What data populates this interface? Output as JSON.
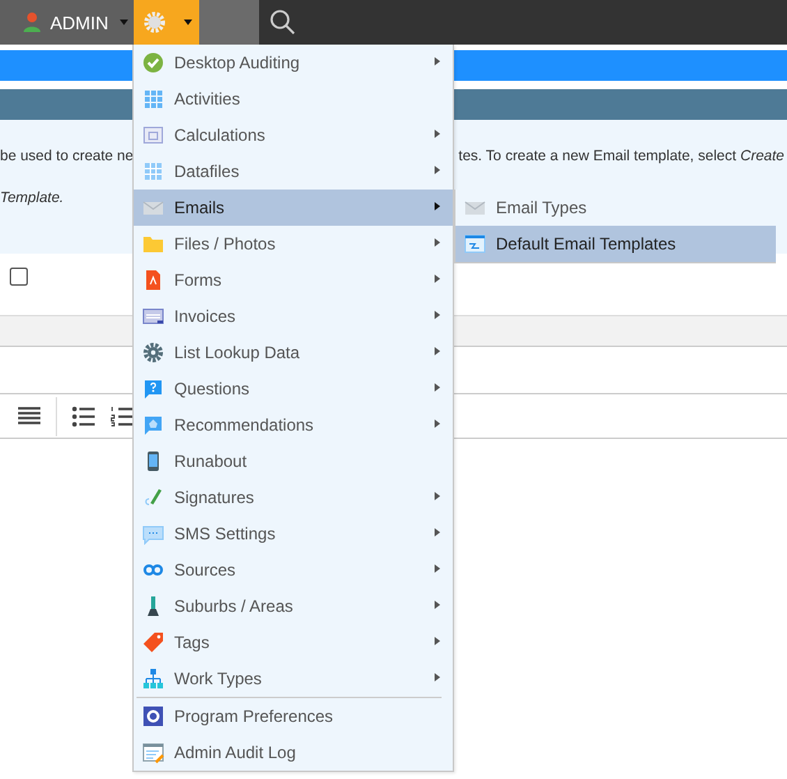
{
  "topbar": {
    "user": "ADMIN"
  },
  "intro": {
    "left": "be used to create ne",
    "right": "tes. To create a new Email template, select *Create*",
    "line2": "Template."
  },
  "checkbox": {
    "checked": false
  },
  "admin_menu": {
    "groups": [
      [
        {
          "label": "Desktop Auditing",
          "has_submenu": true,
          "selected": false
        },
        {
          "label": "Activities",
          "has_submenu": false,
          "selected": false
        },
        {
          "label": "Calculations",
          "has_submenu": true,
          "selected": false
        },
        {
          "label": "Datafiles",
          "has_submenu": true,
          "selected": false
        },
        {
          "label": "Emails",
          "has_submenu": true,
          "selected": true
        },
        {
          "label": "Files / Photos",
          "has_submenu": true,
          "selected": false
        },
        {
          "label": "Forms",
          "has_submenu": true,
          "selected": false
        },
        {
          "label": "Invoices",
          "has_submenu": true,
          "selected": false
        },
        {
          "label": "List Lookup Data",
          "has_submenu": true,
          "selected": false
        },
        {
          "label": "Questions",
          "has_submenu": true,
          "selected": false
        },
        {
          "label": "Recommendations",
          "has_submenu": true,
          "selected": false
        },
        {
          "label": "Runabout",
          "has_submenu": false,
          "selected": false
        },
        {
          "label": "Signatures",
          "has_submenu": true,
          "selected": false
        },
        {
          "label": "SMS Settings",
          "has_submenu": true,
          "selected": false
        },
        {
          "label": "Sources",
          "has_submenu": true,
          "selected": false
        },
        {
          "label": "Suburbs / Areas",
          "has_submenu": true,
          "selected": false
        },
        {
          "label": "Tags",
          "has_submenu": true,
          "selected": false
        },
        {
          "label": "Work Types",
          "has_submenu": true,
          "selected": false
        }
      ],
      [
        {
          "label": "Program Preferences",
          "has_submenu": false,
          "selected": false
        },
        {
          "label": "Admin Audit Log",
          "has_submenu": false,
          "selected": false
        }
      ]
    ]
  },
  "submenu": {
    "items": [
      {
        "label": "Email Types",
        "selected": false
      },
      {
        "label": "Default Email Templates",
        "selected": true
      }
    ]
  }
}
